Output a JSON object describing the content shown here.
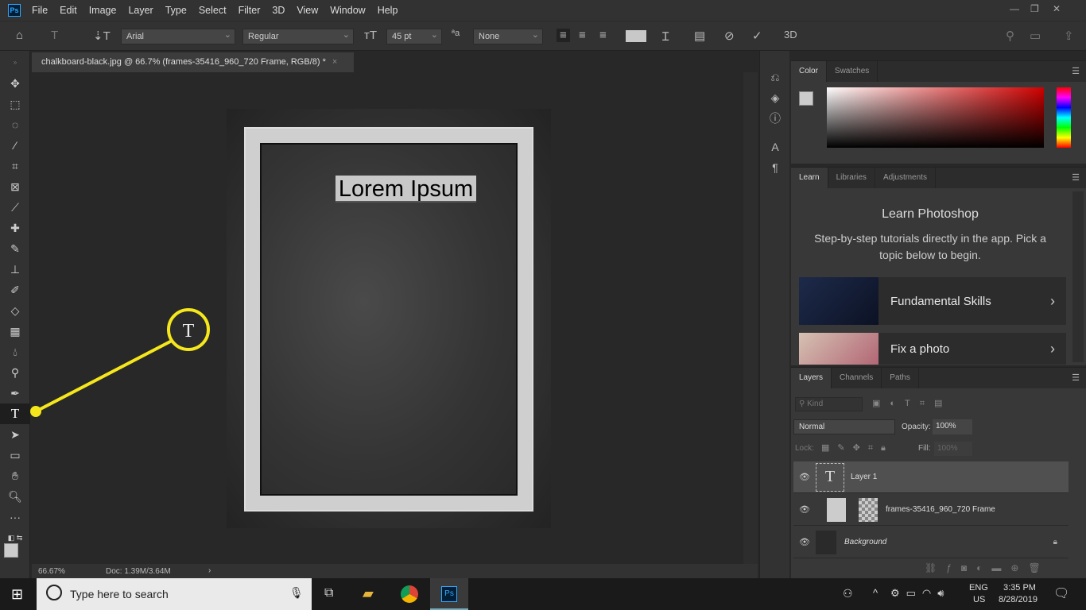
{
  "app": {
    "logo": "Ps"
  },
  "menu": [
    "File",
    "Edit",
    "Image",
    "Layer",
    "Type",
    "Select",
    "Filter",
    "3D",
    "View",
    "Window",
    "Help"
  ],
  "options": {
    "font_family": "Arial",
    "font_style": "Regular",
    "font_size": "45 pt",
    "antialias": "None",
    "label_3d": "3D"
  },
  "document": {
    "tab_title": "chalkboard-black.jpg @ 66.7% (frames-35416_960_720 Frame, RGB/8) *",
    "text_layer_content": "Lorem Ipsum",
    "zoom": "66.67%",
    "doc_size": "Doc: 1.39M/3.64M"
  },
  "color_panel": {
    "tabs": [
      "Color",
      "Swatches"
    ]
  },
  "learn_panel": {
    "tabs": [
      "Learn",
      "Libraries",
      "Adjustments"
    ],
    "title": "Learn Photoshop",
    "description": "Step-by-step tutorials directly in the app. Pick a topic below to begin.",
    "cards": [
      "Fundamental Skills",
      "Fix a photo"
    ]
  },
  "layers_panel": {
    "tabs": [
      "Layers",
      "Channels",
      "Paths"
    ],
    "filter_placeholder": "Kind",
    "blend_mode": "Normal",
    "opacity_label": "Opacity:",
    "opacity": "100%",
    "lock_label": "Lock:",
    "fill_label": "Fill:",
    "fill": "100%",
    "layers": [
      {
        "name": "Layer 1",
        "type": "text",
        "selected": true
      },
      {
        "name": "frames-35416_960_720 Frame",
        "type": "masked"
      },
      {
        "name": "Background",
        "type": "background",
        "locked": true
      }
    ]
  },
  "taskbar": {
    "search_placeholder": "Type here to search",
    "lang": "ENG",
    "region": "US",
    "time": "3:35 PM",
    "date": "8/28/2019"
  },
  "annotation": {
    "color": "#f5e71c",
    "tool_glyph": "T"
  }
}
